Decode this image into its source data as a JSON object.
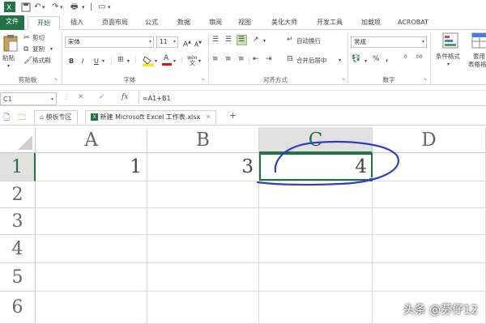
{
  "quick_access": {
    "save_icon": "save-icon",
    "undo_icon": "undo-icon",
    "redo_icon": "redo-icon"
  },
  "tabs": [
    {
      "label": "文件"
    },
    {
      "label": "开始"
    },
    {
      "label": "插入"
    },
    {
      "label": "页面布局"
    },
    {
      "label": "公式"
    },
    {
      "label": "数据"
    },
    {
      "label": "审阅"
    },
    {
      "label": "视图"
    },
    {
      "label": "美化大师"
    },
    {
      "label": "开发工具"
    },
    {
      "label": "加载项"
    },
    {
      "label": "ACROBAT"
    }
  ],
  "ribbon": {
    "clipboard": {
      "paste": "粘贴",
      "cut": "剪切",
      "copy": "复制",
      "format_painter": "格式刷",
      "label": "剪贴板"
    },
    "font": {
      "family": "宋体",
      "size": "11",
      "grow": "A",
      "shrink": "A",
      "bold": "B",
      "italic": "I",
      "underline": "U",
      "phonetic": "wén",
      "label": "字体"
    },
    "alignment": {
      "wrap": "自动换行",
      "merge": "合并后居中",
      "label": "对齐方式"
    },
    "number": {
      "format": "常规",
      "percent": "%",
      "comma": ",",
      "inc_decimal": ".0",
      "dec_decimal": ".00",
      "label": "数字"
    },
    "styles": {
      "conditional": "条件格式",
      "table": "套用",
      "table2": "表格格",
      "label": ""
    }
  },
  "formula_bar": {
    "name_box": "C1",
    "cancel": "✕",
    "enter": "✓",
    "fx": "fx",
    "formula": "=A1+B1"
  },
  "workbook_tabs": [
    {
      "label": "模板专区"
    },
    {
      "label": "新建 Microsoft Excel 工作表.xlsx"
    },
    {
      "label": "+"
    }
  ],
  "sheet": {
    "columns": [
      "A",
      "B",
      "C",
      "D"
    ],
    "rows": [
      "1",
      "2",
      "3",
      "4",
      "5",
      "6"
    ],
    "cells": {
      "A1": "1",
      "B1": "3",
      "C1": "4"
    },
    "selected_cell": "C1",
    "accent_color": "#217346",
    "annotation_color": "#2f3fbf"
  },
  "watermark": "头条 @芬仔12"
}
